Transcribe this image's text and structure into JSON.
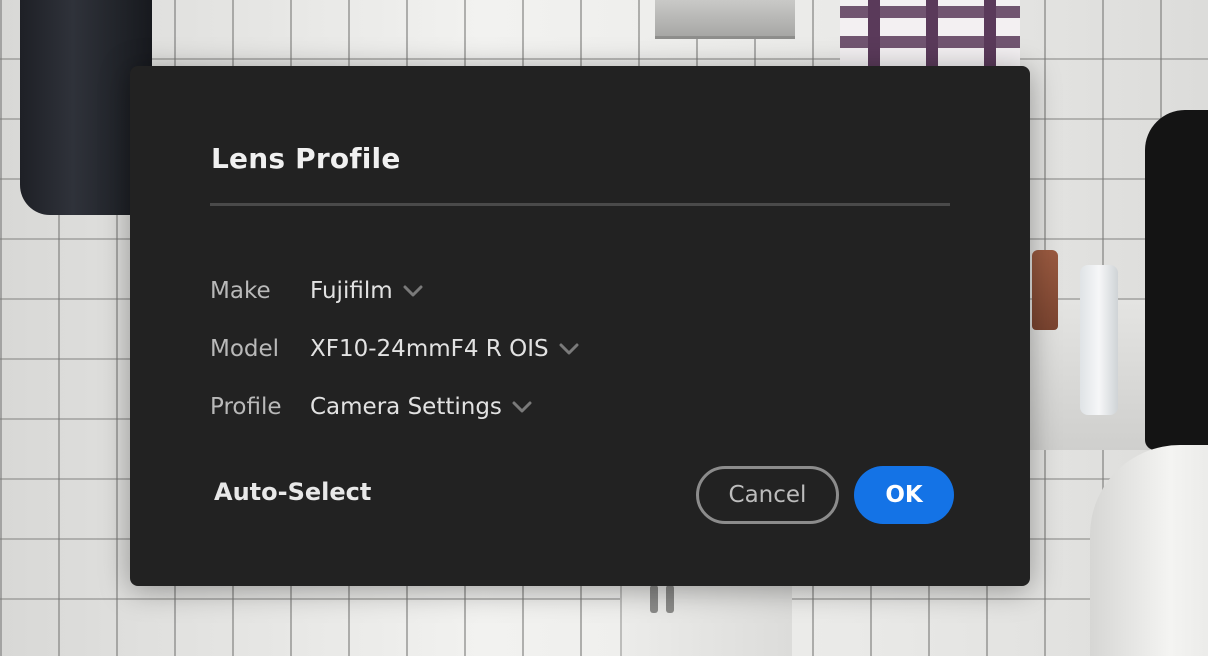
{
  "dialog": {
    "title": "Lens Profile",
    "fields": [
      {
        "label": "Make",
        "value": "Fujifilm"
      },
      {
        "label": "Model",
        "value": "XF10-24mmF4 R OIS"
      },
      {
        "label": "Profile",
        "value": "Camera Settings"
      }
    ],
    "auto_select_label": "Auto-Select",
    "cancel_label": "Cancel",
    "ok_label": "OK"
  },
  "colors": {
    "dialog_background": "#222222",
    "accent": "#1473e6",
    "label_text": "#b9b9b9",
    "value_text": "#e2e2e2"
  },
  "icons": {
    "dropdown": "chevron-down-icon"
  }
}
